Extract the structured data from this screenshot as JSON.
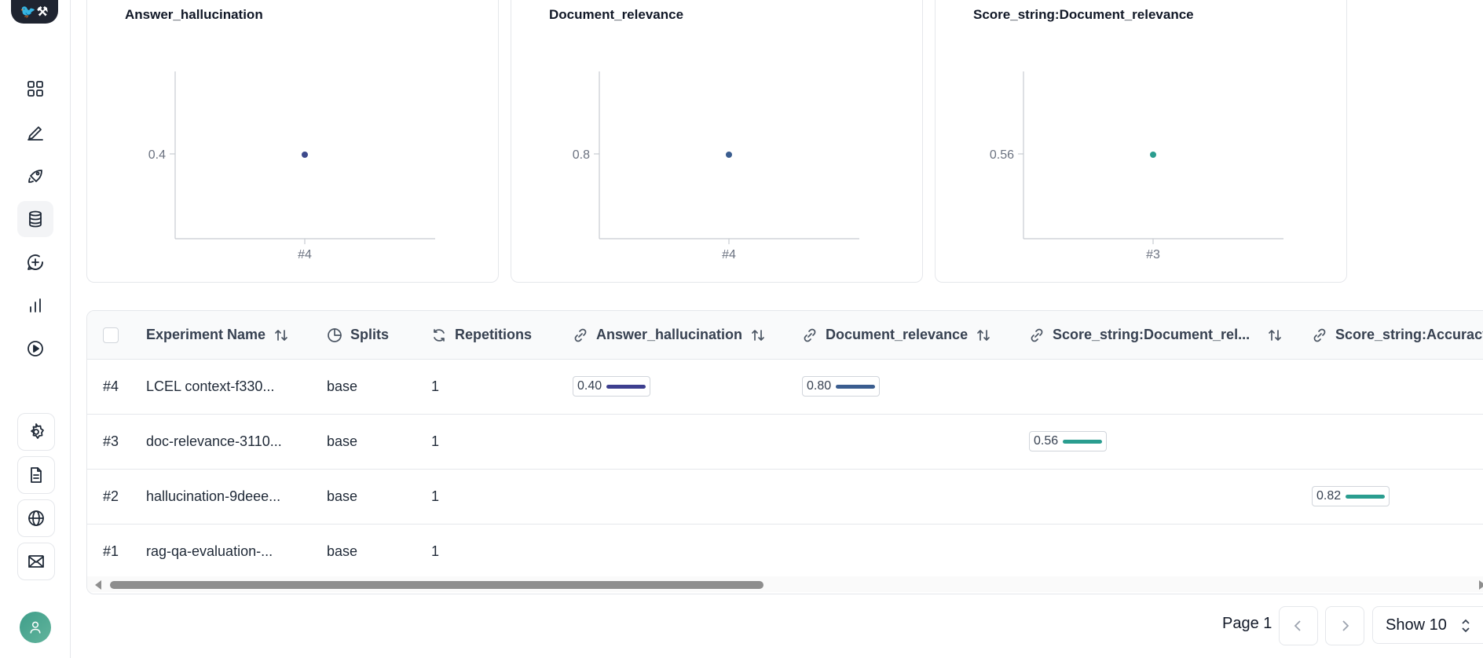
{
  "logo": {
    "text": "🐦⚒"
  },
  "sidebar": {
    "items": [
      {
        "name": "dashboard-icon"
      },
      {
        "name": "pencil-icon"
      },
      {
        "name": "rocket-icon"
      },
      {
        "name": "database-icon",
        "active": true
      },
      {
        "name": "chat-plus-icon"
      },
      {
        "name": "bar-chart-icon"
      },
      {
        "name": "play-icon"
      }
    ],
    "bottom": [
      {
        "name": "settings-icon"
      },
      {
        "name": "document-icon"
      },
      {
        "name": "globe-icon"
      },
      {
        "name": "mail-icon"
      }
    ]
  },
  "charts": [
    {
      "title": "Answer_hallucination",
      "y_tick": "0.4",
      "x_tick": "#4",
      "color": "#3d4a8c"
    },
    {
      "title": "Document_relevance",
      "y_tick": "0.8",
      "x_tick": "#4",
      "color": "#3a5d8f"
    },
    {
      "title": "Score_string:Document_relevance",
      "y_tick": "0.56",
      "x_tick": "#3",
      "color": "#2a9d8f"
    }
  ],
  "chart_data": [
    {
      "type": "scatter",
      "title": "Answer_hallucination",
      "x": [
        "#4"
      ],
      "series": [
        {
          "values": [
            0.4
          ]
        }
      ]
    },
    {
      "type": "scatter",
      "title": "Document_relevance",
      "x": [
        "#4"
      ],
      "series": [
        {
          "values": [
            0.8
          ]
        }
      ]
    },
    {
      "type": "scatter",
      "title": "Score_string:Document_relevance",
      "x": [
        "#3"
      ],
      "series": [
        {
          "values": [
            0.56
          ]
        }
      ]
    }
  ],
  "table": {
    "headers": {
      "experiment_name": "Experiment Name",
      "splits": "Splits",
      "repetitions": "Repetitions",
      "answer_hallucination": "Answer_hallucination",
      "document_relevance": "Document_relevance",
      "score_doc_rel": "Score_string:Document_rel...",
      "score_accuracy": "Score_string:Accuracy"
    },
    "rows": [
      {
        "id": "#4",
        "name": "LCEL context-f330...",
        "split": "base",
        "reps": "1",
        "answer_hallucination": {
          "label": "0.40",
          "value": 0.4,
          "color": "#3d3f8f"
        },
        "document_relevance": {
          "label": "0.80",
          "value": 0.8,
          "color": "#3a5d8f"
        }
      },
      {
        "id": "#3",
        "name": "doc-relevance-3110...",
        "split": "base",
        "reps": "1",
        "score_doc_rel": {
          "label": "0.56",
          "value": 0.56,
          "color": "#2a9d8f"
        }
      },
      {
        "id": "#2",
        "name": "hallucination-9deee...",
        "split": "base",
        "reps": "1",
        "score_accuracy": {
          "label": "0.82",
          "value": 0.82,
          "color": "#2a9d8f"
        }
      },
      {
        "id": "#1",
        "name": "rag-qa-evaluation-...",
        "split": "base",
        "reps": "1"
      }
    ]
  },
  "pagination": {
    "page_label": "Page 1",
    "show_label": "Show 10"
  }
}
